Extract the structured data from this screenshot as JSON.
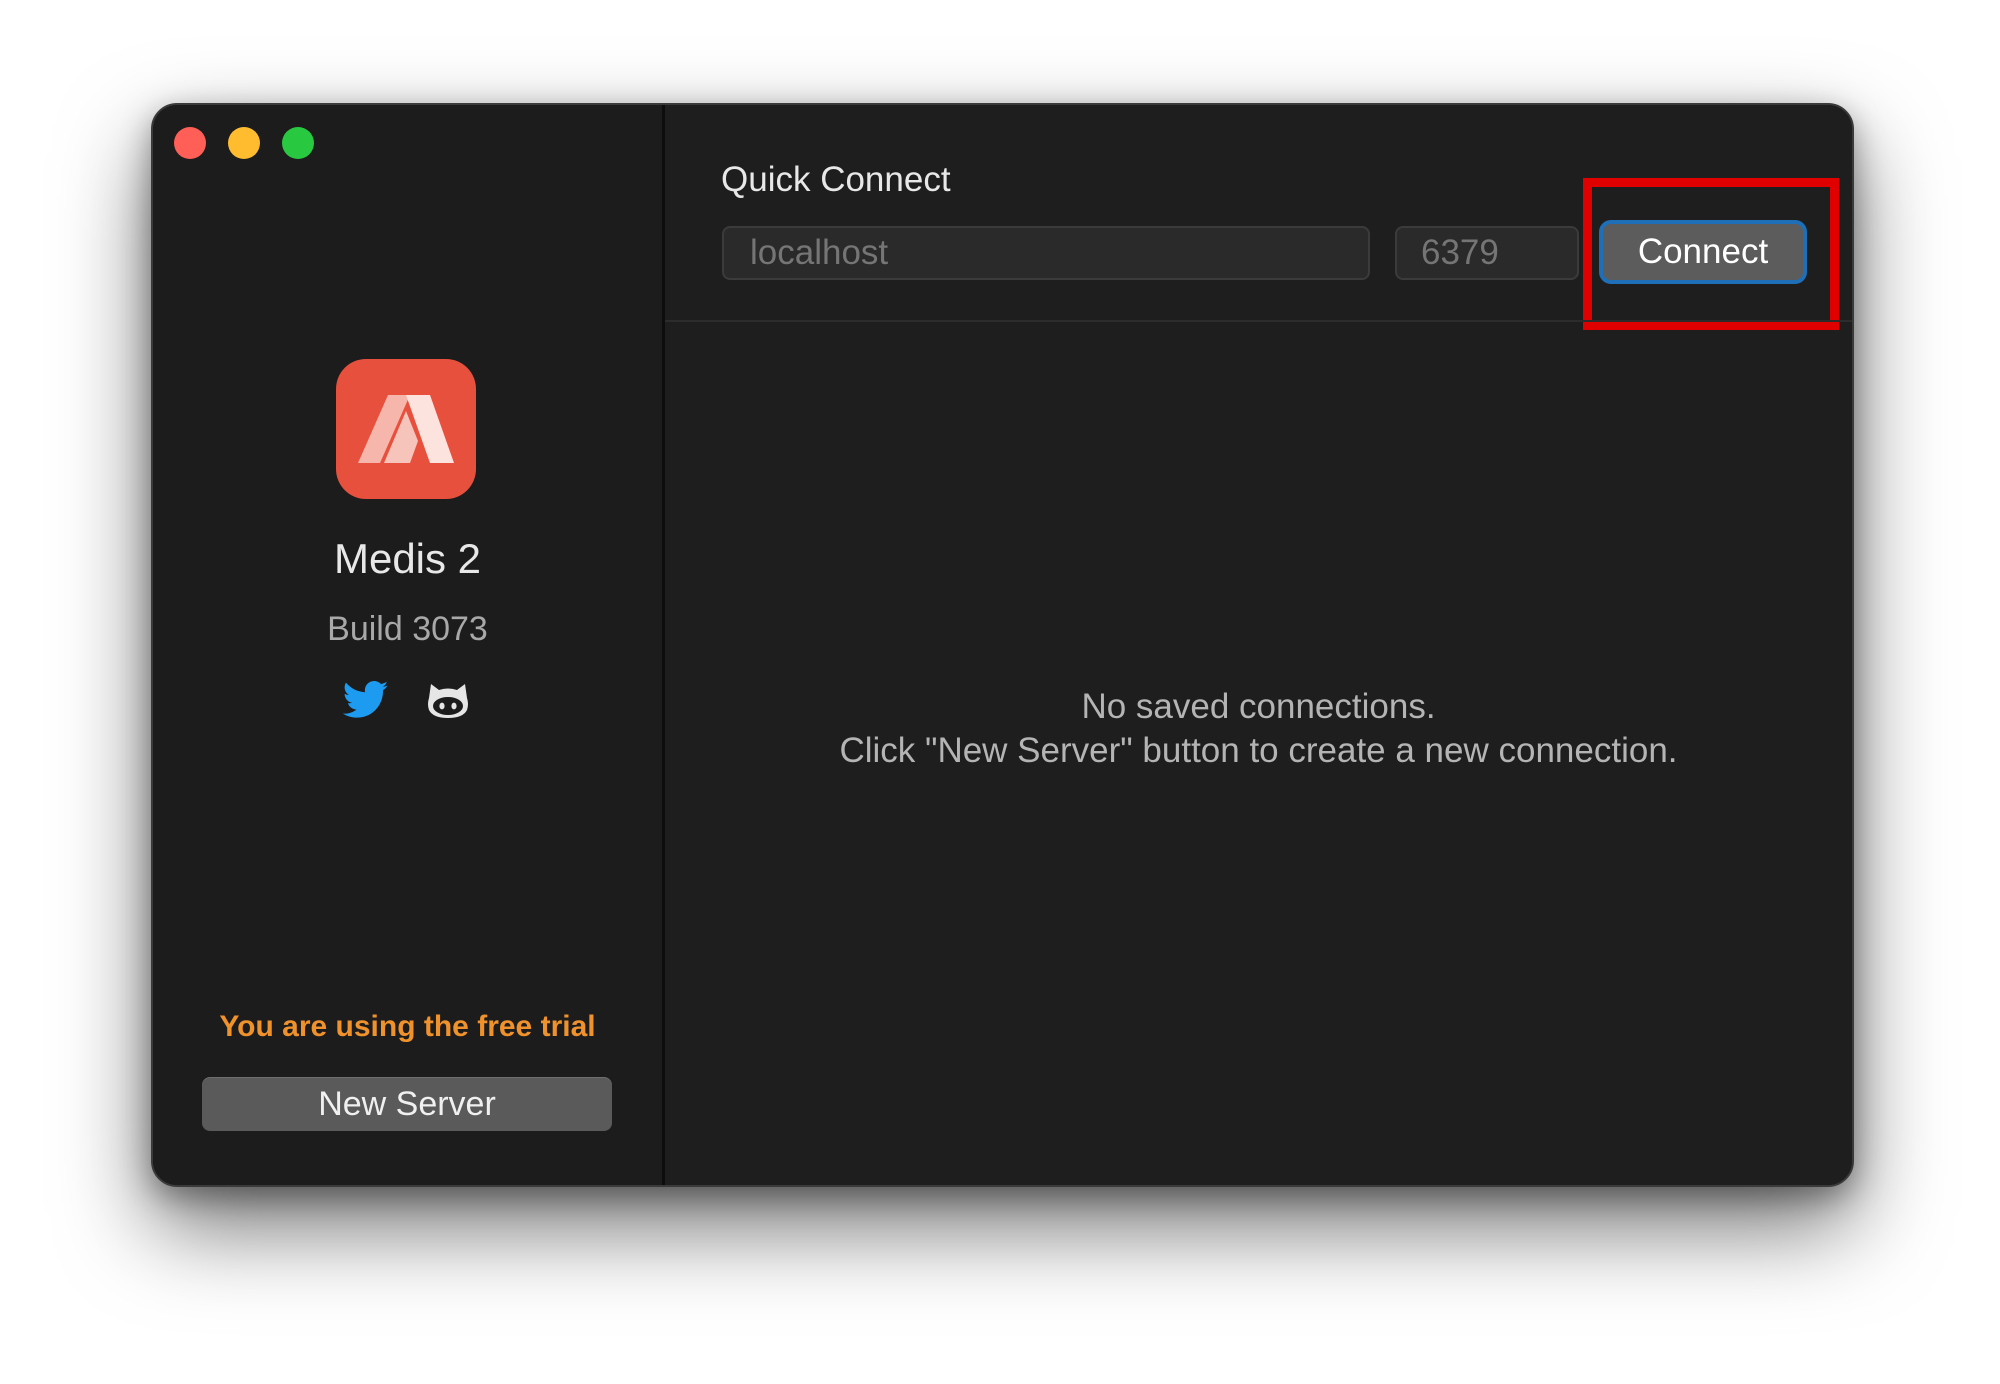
{
  "window": {
    "traffic_lights": {
      "close": "#ff5f57",
      "minimize": "#febc2e",
      "zoom": "#28c840"
    }
  },
  "sidebar": {
    "app_icon": {
      "name": "medis-logo-icon",
      "color": "#e8503e"
    },
    "app_name": "Medis 2",
    "build": "Build 3073",
    "social": [
      {
        "name": "twitter-icon",
        "color": "#1d9bf0"
      },
      {
        "name": "github-icon",
        "color": "#e6e6e6"
      }
    ],
    "trial_notice": "You are using the free trial",
    "trial_color": "#f0922b",
    "new_server_label": "New Server"
  },
  "quick_connect": {
    "title": "Quick Connect",
    "host_placeholder": "localhost",
    "port_placeholder": "6379",
    "connect_label": "Connect",
    "highlight_color": "#e00000"
  },
  "empty_state": {
    "line1": "No saved connections.",
    "line2": "Click \"New Server\" button to create a new connection."
  }
}
